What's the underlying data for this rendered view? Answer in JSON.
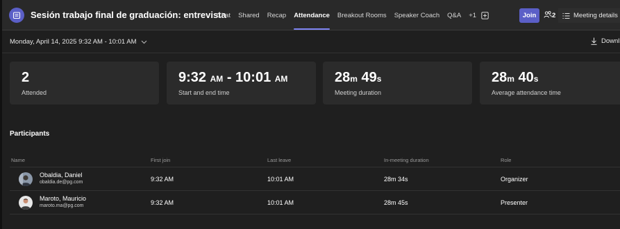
{
  "header": {
    "title": "Sesión trabajo final de graduación: entrevista",
    "tabs": [
      {
        "label": "Chat",
        "active": false
      },
      {
        "label": "Shared",
        "active": false
      },
      {
        "label": "Recap",
        "active": false
      },
      {
        "label": "Attendance",
        "active": true
      },
      {
        "label": "Breakout Rooms",
        "active": false
      },
      {
        "label": "Speaker Coach",
        "active": false
      },
      {
        "label": "Q&A",
        "active": false
      },
      {
        "label": "+1",
        "active": false
      }
    ],
    "join_label": "Join",
    "participants_count": "2",
    "meeting_details_label": "Meeting details"
  },
  "subbar": {
    "date_range": "Monday, April 14, 2025 9:32 AM - 10:01 AM",
    "download_label": "Downl"
  },
  "stats": {
    "attended": {
      "value": "2",
      "label": "Attended"
    },
    "time": {
      "start": "9:32",
      "start_ampm": "AM",
      "sep": " - ",
      "end": "10:01",
      "end_ampm": "AM",
      "label": "Start and end time"
    },
    "duration": {
      "min": "28",
      "min_unit": "m",
      "sec": " 49",
      "sec_unit": "s",
      "label": "Meeting duration"
    },
    "average": {
      "min": "28",
      "min_unit": "m",
      "sec": " 40",
      "sec_unit": "s",
      "label": "Average attendance time"
    }
  },
  "participants": {
    "title": "Participants",
    "columns": [
      "Name",
      "First join",
      "Last leave",
      "In-meeting duration",
      "Role"
    ],
    "rows": [
      {
        "name": "Obaldia, Daniel",
        "email": "obaldia.de@pg.com",
        "first_join": "9:32 AM",
        "last_leave": "10:01 AM",
        "duration": "28m 34s",
        "role": "Organizer"
      },
      {
        "name": "Maroto, Mauricio",
        "email": "maroto.ma@pg.com",
        "first_join": "9:32 AM",
        "last_leave": "10:01 AM",
        "duration": "28m 45s",
        "role": "Presenter"
      }
    ]
  },
  "colors": {
    "accent": "#5b5fc7",
    "tab_underline": "#7f85f5",
    "background": "#1f1f1f",
    "card": "#2b2b2b"
  }
}
